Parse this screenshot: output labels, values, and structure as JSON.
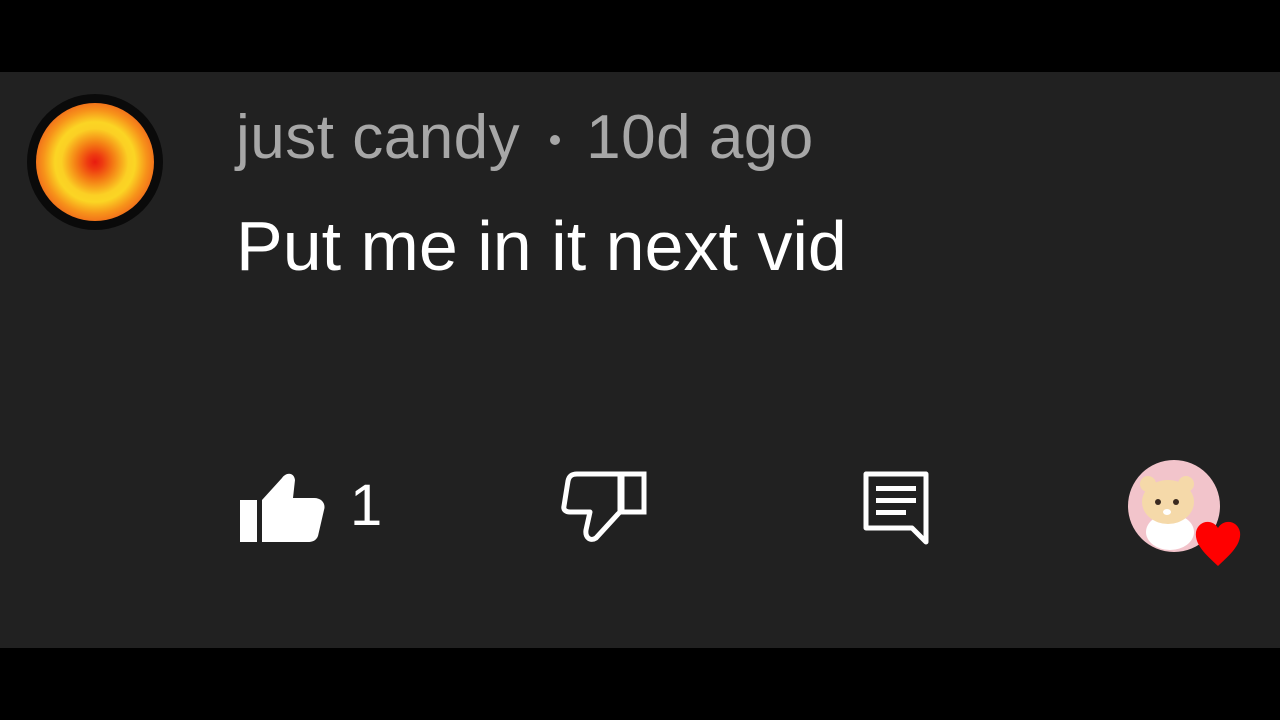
{
  "comment": {
    "author": "just candy",
    "age": "10d ago",
    "text": "Put me in it next vid",
    "like_count": "1"
  },
  "actions": {
    "like_icon": "thumbs-up-icon",
    "dislike_icon": "thumbs-down-icon",
    "reply_icon": "reply-comment-icon",
    "creator_heart_icon": "heart-icon"
  },
  "colors": {
    "background": "#212121",
    "letterbox": "#000000",
    "author_text": "#a7a7a7",
    "comment_text": "#ffffff",
    "heart": "#ff0000"
  }
}
